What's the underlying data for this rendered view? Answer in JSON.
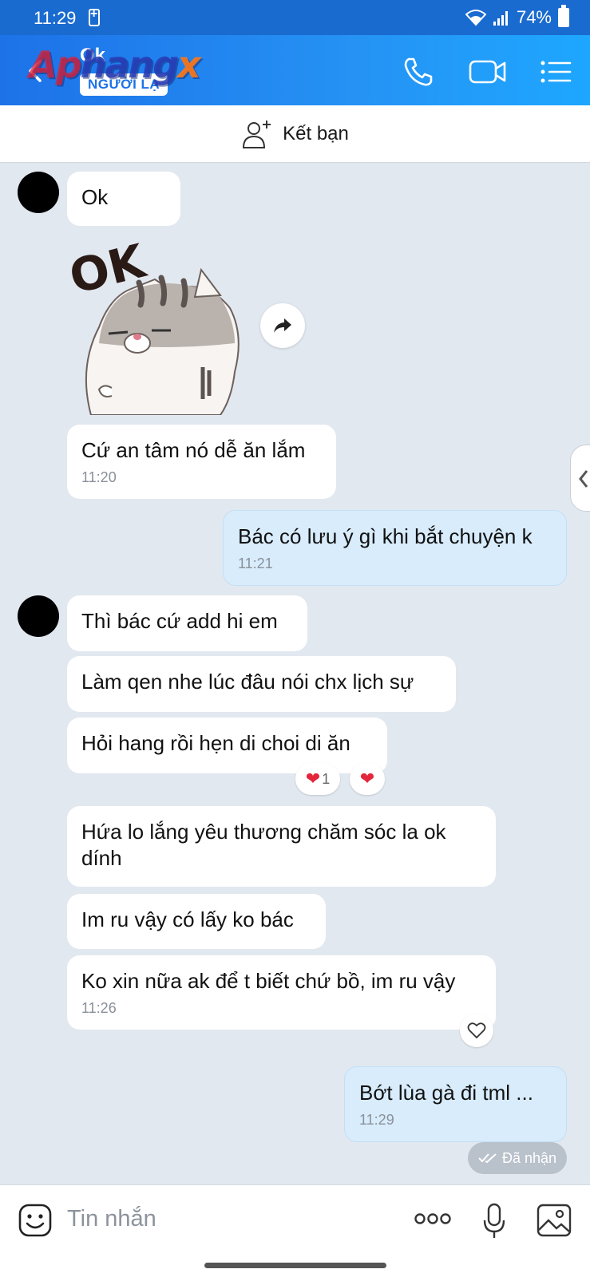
{
  "status_bar": {
    "time": "11:29",
    "battery": "74%"
  },
  "header": {
    "contact_name": "Ok",
    "badge": "NGƯỜI LẠ",
    "watermark": [
      "Ap",
      "hang",
      "x"
    ],
    "actions": [
      "phone-icon",
      "video-call-icon",
      "menu-list-icon"
    ]
  },
  "add_friend": {
    "label": "Kết bạn"
  },
  "messages": {
    "m1": {
      "text": "Ok"
    },
    "m2": {
      "text": "Cứ an tâm nó dễ ăn lắm",
      "time": "11:20"
    },
    "m3": {
      "text": "Bác có lưu ý gì khi bắt chuyện k",
      "time": "11:21"
    },
    "m4": {
      "text": "Thì bác cứ add hi em"
    },
    "m5": {
      "text": "Làm qen nhe lúc đâu nói chx lịch sự"
    },
    "m6": {
      "text": "Hỏi hang rồi hẹn di choi di ăn",
      "reaction_count": "1"
    },
    "m7": {
      "text": "Hứa lo lắng yêu thương chăm sóc la ok dính"
    },
    "m8": {
      "text": "Im ru vậy có lấy ko bác"
    },
    "m9": {
      "text": "Ko xin nữa ak để t biết chứ bồ, im ru vậy",
      "time": "11:26"
    },
    "m10": {
      "text": "Bớt lùa gà đi tml ...",
      "time": "11:29"
    }
  },
  "sticker": {
    "text": "OK"
  },
  "delivery_status": "Đã nhận",
  "composer": {
    "placeholder": "Tin nhắn"
  },
  "colors": {
    "header": "#1d72e8",
    "mine_bubble": "#d8ecfc",
    "chat_bg": "#e2e8f0",
    "reaction_heart": "#e3263b"
  }
}
